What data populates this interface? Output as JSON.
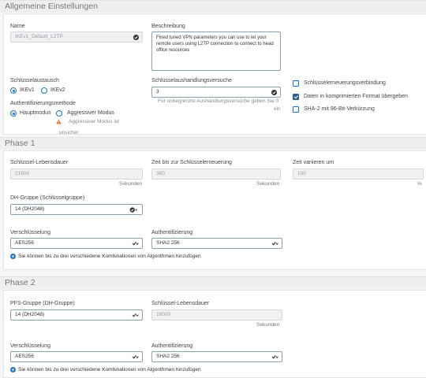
{
  "general": {
    "header": "Allgemeine Einstellungen",
    "name_label": "Name",
    "name_value": "IKEv1_Default_L2TP",
    "description_label": "Beschreibung",
    "description_value": "Fined tuned VPN parameters you can use to let your remote users using L2TP connection to connect to head office resources",
    "key_exchange_label": "Schlüsselaustausch",
    "ikev1_label": "IKEv1",
    "ikev2_label": "IKEv2",
    "auth_method_label": "Authentifizierungsmethode",
    "main_mode_label": "Hauptmodus",
    "aggressive_mode_label": "Aggressiver Modus",
    "aggressive_warning_line1": "Aggressiver Modus ist",
    "aggressive_warning_line2": "unsicher",
    "negotiation_attempts_label": "Schlüsselaushandlungsversuche",
    "negotiation_attempts_value": "3",
    "unlimited_hint_line1": "Für unbegrenzte Aushandlungsversuche geben Sie 0",
    "unlimited_hint_line2": "ein",
    "rekey_connection_label": "Schlüsselerneuerungsverbindung",
    "compressed_format_label": "Daten in komprimierten Format übergeben",
    "sha2_label": "SHA-2 mit 96-Bit-Verkürzung"
  },
  "phase1": {
    "header": "Phase 1",
    "key_lifetime_label": "Schlüssel-Lebensdauer",
    "key_lifetime_value": "21600",
    "key_lifetime_unit": "Sekunden",
    "rekey_time_label": "Zeit bis zur Schlüsselerneuerung",
    "rekey_time_value": "360",
    "rekey_time_unit": "Sekunden",
    "time_vary_label": "Zeit variieren um",
    "time_vary_value": "100",
    "time_vary_unit": "%",
    "dh_group_label": "DH-Gruppe (Schlüsselgruppe)",
    "dh_group_value": "14 (DH2048)",
    "encryption_label": "Verschlüsselung",
    "encryption_value": "AES256",
    "authentication_label": "Authentifizierung",
    "authentication_value": "SHA2 256",
    "add_combo_text": "Sie können bis zu drei verschiedene Kombinationen von Algorithmen hinzufügen"
  },
  "phase2": {
    "header": "Phase 2",
    "pfs_group_label": "PFS-Gruppe (DH-Gruppe)",
    "pfs_group_value": "14 (DH2048)",
    "key_lifetime_label": "Schlüssel-Lebensdauer",
    "key_lifetime_value": "18000",
    "key_lifetime_unit": "Sekunden",
    "encryption_label": "Verschlüsselung",
    "encryption_value": "AES256",
    "authentication_label": "Authentifizierung",
    "authentication_value": "SHA2 256",
    "add_combo_text": "Sie können bis zu drei verschiedene Kombinationen von Algorithmen hinzufügen"
  },
  "colors": {
    "accent": "#1a73c8",
    "warning": "#e8772e",
    "section_bg": "#eeeff0"
  }
}
